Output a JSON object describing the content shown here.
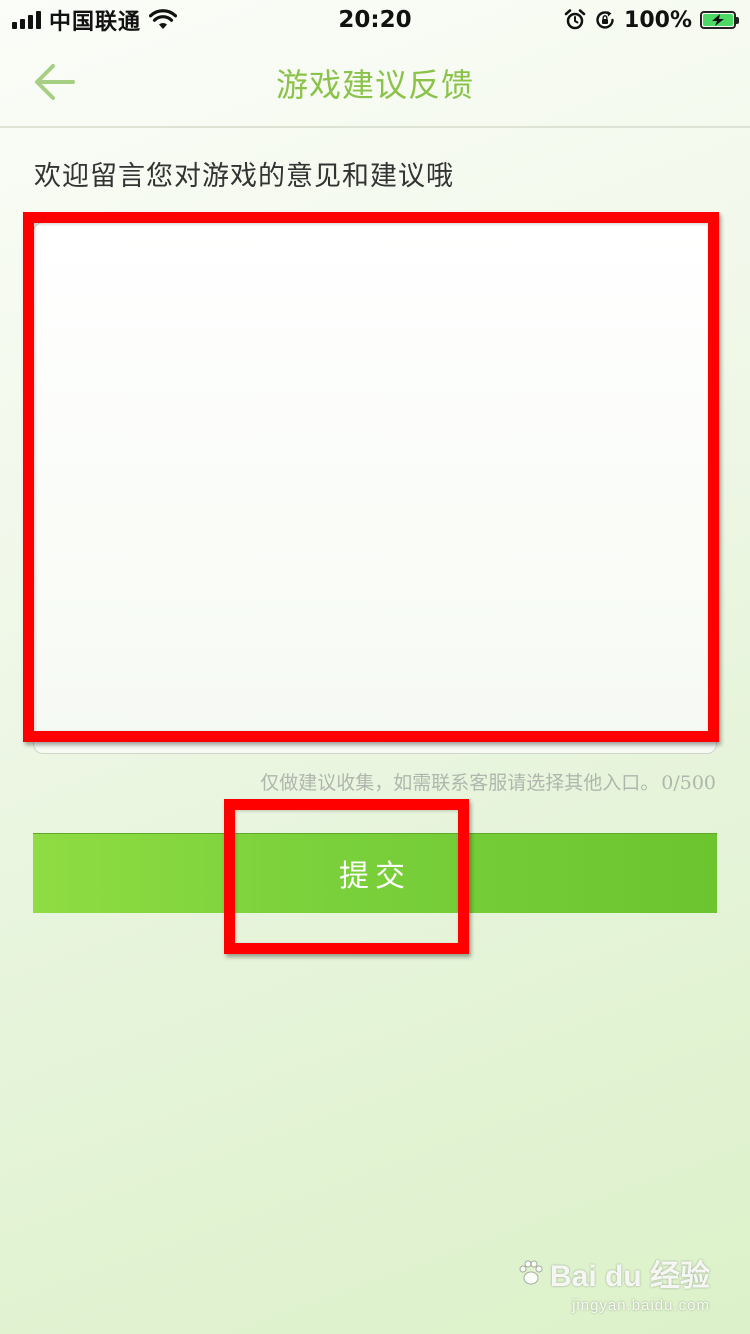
{
  "status_bar": {
    "carrier": "中国联通",
    "time": "20:20",
    "battery_percent": "100%",
    "battery_level": 1.0,
    "icons": [
      "signal-icon",
      "wifi-icon",
      "alarm-icon",
      "rotation-lock-icon",
      "battery-charging-icon"
    ]
  },
  "nav": {
    "title": "游戏建议反馈",
    "back_icon": "back-arrow-icon"
  },
  "feedback": {
    "prompt": "欢迎留言您对游戏的意见和建议哦",
    "textarea_value": "",
    "textarea_placeholder": "",
    "hint": "仅做建议收集，如需联系客服请选择其他入口。",
    "char_count": "0/500"
  },
  "submit": {
    "label": "提交"
  },
  "watermark": {
    "brand": "Bai du 经验",
    "url": "jingyan.baidu.com"
  },
  "colors": {
    "accent": "#8bc34a",
    "button_start": "#8fdc43",
    "button_end": "#6cc52f",
    "annotation": "#ff0000"
  }
}
